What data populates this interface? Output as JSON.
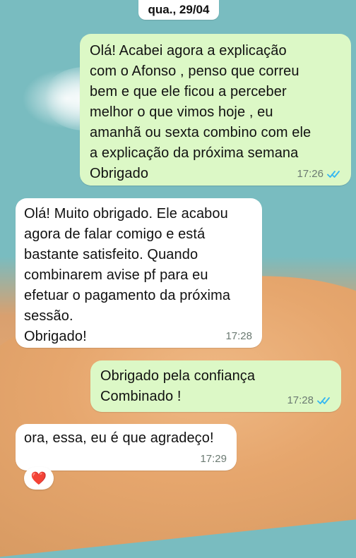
{
  "chat": {
    "date_label": "qua., 29/04",
    "messages": [
      {
        "direction": "outgoing",
        "text": "Olá! Acabei agora a explicação\ncom o Afonso , penso que correu\nbem e que ele ficou a perceber\nmelhor o que vimos hoje , eu\namanhã ou sexta combino com ele\na explicação da próxima semana\nObrigado",
        "time": "17:26",
        "status_icon": "double-check-read"
      },
      {
        "direction": "incoming",
        "text": "Olá! Muito obrigado. Ele acabou\nagora de falar comigo e está\nbastante satisfeito. Quando\ncombinarem avise pf para eu\nefetuar o pagamento da próxima\nsessão.\nObrigado!",
        "time": "17:28"
      },
      {
        "direction": "outgoing",
        "text": "Obrigado pela confiança\nCombinado !",
        "time": "17:28",
        "status_icon": "double-check-read"
      },
      {
        "direction": "incoming",
        "text": "ora, essa, eu é que agradeço!",
        "time": "17:29",
        "reaction": "❤️"
      }
    ]
  },
  "colors": {
    "outgoing_bubble": "#dcf8c6",
    "incoming_bubble": "#ffffff",
    "read_check": "#34b7f1"
  }
}
